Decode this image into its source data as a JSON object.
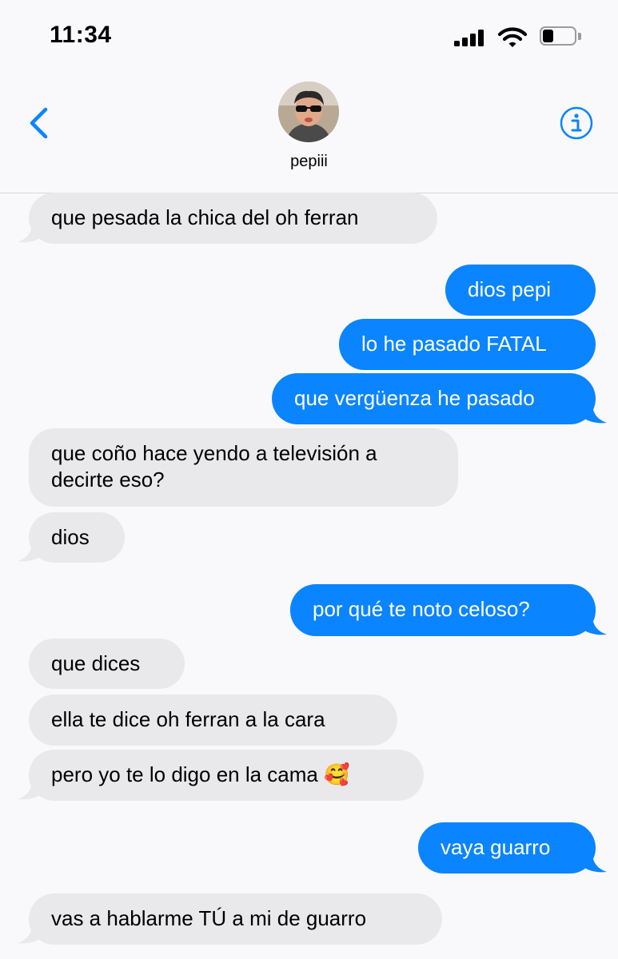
{
  "status_bar": {
    "time": "11:34",
    "battery_level": 0.35
  },
  "header": {
    "contact_name": "pepiii",
    "back_icon": "chevron-left-icon",
    "info_icon": "info-circle-icon"
  },
  "colors": {
    "sent": "#0a84ff",
    "received": "#e9e9eb",
    "accent": "#0a84ff"
  },
  "messages": [
    {
      "from": "contact",
      "text": "que pesada la chica del oh ferran"
    },
    {
      "from": "me",
      "text": "dios pepi"
    },
    {
      "from": "me",
      "text": "lo he pasado FATAL"
    },
    {
      "from": "me",
      "text": "que vergüenza he pasado"
    },
    {
      "from": "contact",
      "text": "que coño hace yendo a televisión a decirte eso?"
    },
    {
      "from": "contact",
      "text": "dios"
    },
    {
      "from": "me",
      "text": "por qué te noto celoso?"
    },
    {
      "from": "contact",
      "text": "que dices"
    },
    {
      "from": "contact",
      "text": "ella te dice oh ferran a la cara"
    },
    {
      "from": "contact",
      "text": "pero yo te lo digo en la cama 🥰"
    },
    {
      "from": "me",
      "text": "vaya guarro"
    },
    {
      "from": "contact",
      "text": "vas a hablarme TÚ a mi de guarro"
    }
  ]
}
